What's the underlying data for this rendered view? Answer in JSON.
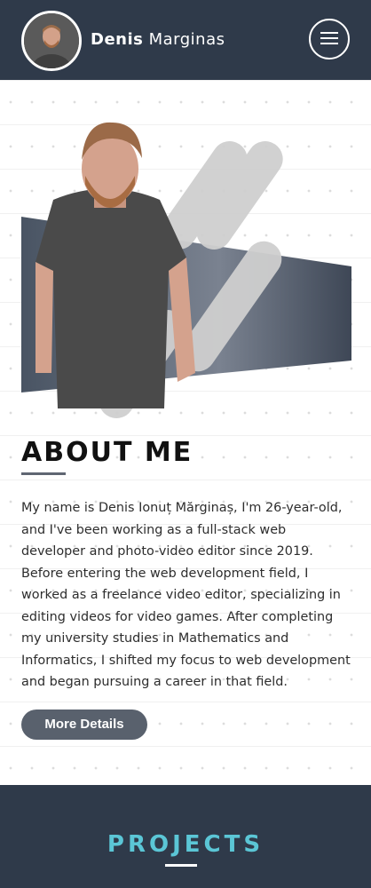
{
  "header": {
    "first_name": "Denis",
    "last_name": "Marginas",
    "avatar_alt": "Denis Marginas avatar",
    "menu_icon": "hamburger-menu-icon"
  },
  "about": {
    "title": "ABOUT ME",
    "bio": "My name is Denis Ionuț Mărginaș, I'm 26-year-old, and I've been working as a full-stack web developer and photo-video editor since 2019. Before entering the web development field, I worked as a freelance video editor, specializing in editing videos for video games. After completing my university studies in Mathematics and Informatics, I shifted my focus to web development and began pursuing a career in that field.",
    "button_label": "More Details"
  },
  "projects": {
    "title": "PROJECTS"
  },
  "colors": {
    "header_bg": "#2f3a4a",
    "accent": "#5bc6d6",
    "button_bg": "#59616d"
  }
}
